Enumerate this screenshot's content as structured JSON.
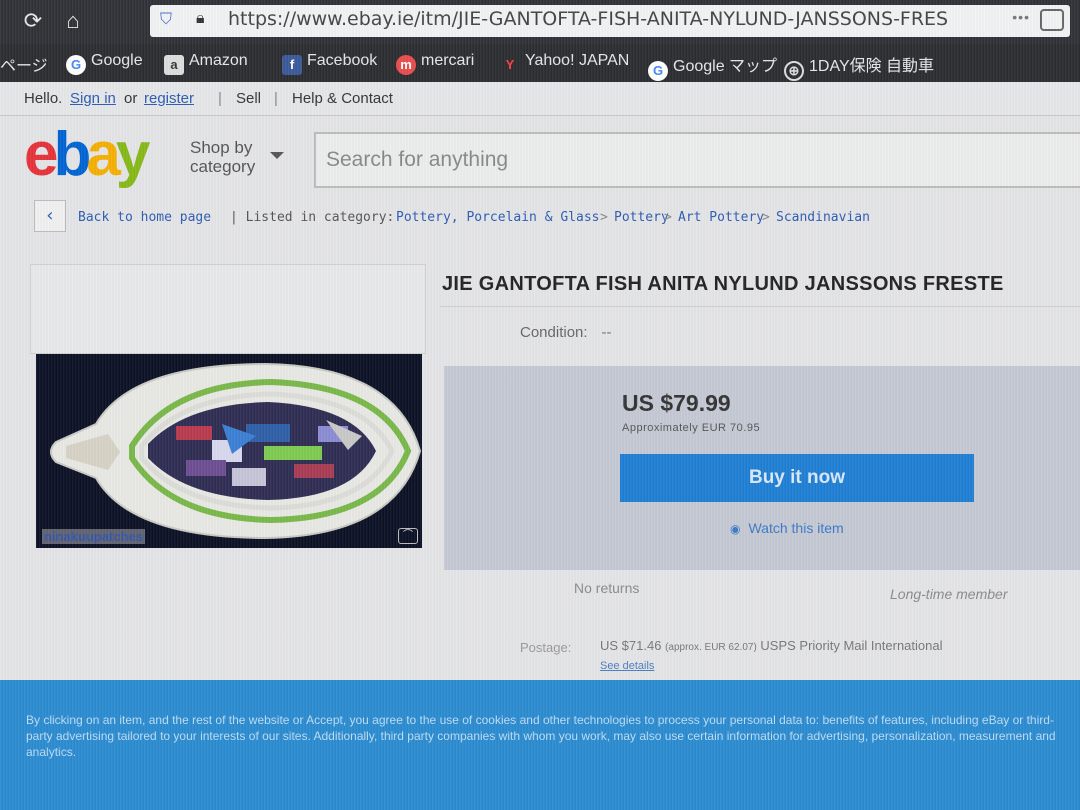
{
  "browser": {
    "url": "https://www.ebay.ie/itm/JIE-GANTOFTA-FISH-ANITA-NYLUND-JANSSONS-FRES",
    "more": "•••"
  },
  "bookmarks": [
    {
      "label": "ページ"
    },
    {
      "label": "Google"
    },
    {
      "label": "Amazon"
    },
    {
      "label": "Facebook"
    },
    {
      "label": "mercari"
    },
    {
      "label": "Yahoo! JAPAN"
    },
    {
      "label": "Google マップ"
    },
    {
      "label": "1DAY保険 自動車"
    }
  ],
  "header": {
    "hello": "Hello.",
    "signin": "Sign in",
    "or": "or",
    "register": "register",
    "sell": "Sell",
    "help": "Help & Contact"
  },
  "logo": {
    "e": "e",
    "b": "b",
    "a": "a",
    "y": "y"
  },
  "shop_by": {
    "line1": "Shop by",
    "line2": "category"
  },
  "search": {
    "placeholder": "Search for anything"
  },
  "breadcrumb": {
    "back": "Back to home page",
    "listed": "| Listed in category:",
    "items": [
      "Pottery, Porcelain & Glass",
      "Pottery",
      "Art Pottery",
      "Scandinavian"
    ],
    "sep": ">"
  },
  "photo": {
    "watermark": "ninakuupatches"
  },
  "item": {
    "title": "JIE GANTOFTA FISH ANITA NYLUND JANSSONS FRESTE",
    "condition_label": "Condition:",
    "condition_value": "--",
    "price": "US $79.99",
    "approx": "Approximately EUR 70.95",
    "buy_now": "Buy it now",
    "watch": "Watch this item",
    "returns": "No returns",
    "member": "Long-time member",
    "postage_label": "Postage:",
    "postage_value": "US $71.46",
    "postage_approx": "(approx. EUR 62.07)",
    "postage_service": "USPS Priority Mail International",
    "see_details": "See details"
  },
  "cookie": {
    "text": "By clicking on an item, and the rest of the website or Accept, you agree to the use of cookies and other technologies to process your personal data to: benefits of features, including eBay or third-party advertising tailored to your interests of our sites. Additionally, third party companies with whom you work, may also use certain information for advertising, personalization, measurement and analytics."
  },
  "colors": {
    "accent": "#1f7fd4",
    "logo_red": "#e53238",
    "logo_blue": "#0064d2",
    "logo_yellow": "#f5af02",
    "logo_green": "#86b817",
    "cookie_bar": "#2a8bd0"
  }
}
